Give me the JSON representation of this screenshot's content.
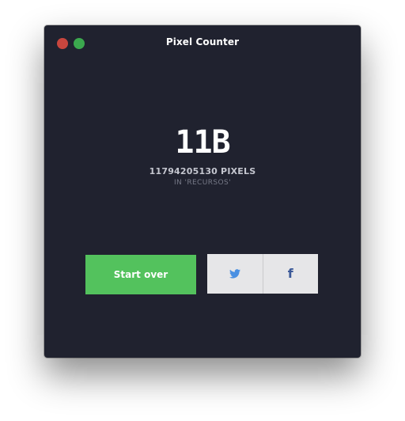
{
  "window": {
    "title": "Pixel Counter",
    "controls": [
      "close",
      "zoom"
    ]
  },
  "result": {
    "big_count": "11B",
    "pixels_line": "11794205130 PIXELS",
    "folder_line": "IN 'RECURSOS'"
  },
  "actions": {
    "start_over_label": "Start over",
    "share": [
      {
        "icon": "twitter-icon",
        "color": "#4a90e2"
      },
      {
        "icon": "facebook-icon",
        "color": "#3b5998"
      }
    ]
  },
  "colors": {
    "window_bg": "#20222f",
    "accent_green": "#53c25d",
    "close_red": "#c8463e",
    "zoom_green": "#3ba84e",
    "share_bg": "#e6e6e8"
  }
}
